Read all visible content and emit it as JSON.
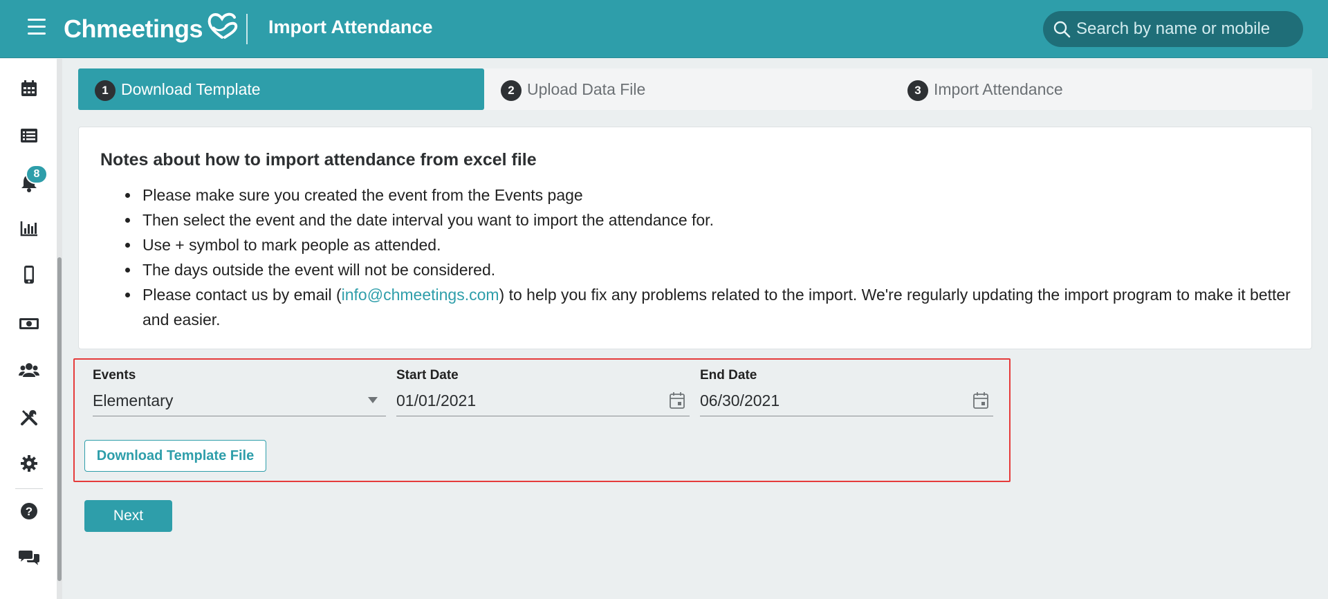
{
  "header": {
    "brand": "Chmeetings",
    "title": "Import Attendance",
    "search_placeholder": "Search by name or mobile"
  },
  "sidebar": {
    "items": [
      {
        "icon": "calendar-icon"
      },
      {
        "icon": "list-icon"
      },
      {
        "icon": "bell-icon",
        "badge": "8"
      },
      {
        "icon": "bar-chart-icon"
      },
      {
        "icon": "mobile-icon"
      },
      {
        "icon": "money-icon"
      },
      {
        "icon": "groups-icon"
      },
      {
        "icon": "tools-icon"
      },
      {
        "icon": "gear-icon"
      },
      {
        "icon": "help-icon"
      },
      {
        "icon": "chat-icon"
      }
    ]
  },
  "steps": [
    {
      "num": "1",
      "label": "Download Template",
      "active": true
    },
    {
      "num": "2",
      "label": "Upload Data File",
      "active": false
    },
    {
      "num": "3",
      "label": "Import Attendance",
      "active": false
    }
  ],
  "notes": {
    "title": "Notes about how to import attendance from excel file",
    "items": [
      "Please make sure you created the event from the Events page",
      "Then select the event and the date interval you want to import the attendance for.",
      "Use + symbol to mark people as attended.",
      "The days outside the event will not be considered."
    ],
    "contact_prefix": "Please contact us by email (",
    "contact_email": "info@chmeetings.com",
    "contact_suffix": ") to help you fix any problems related to the import. We're regularly updating the import program to make it better and easier."
  },
  "form": {
    "events_label": "Events",
    "events_value": "Elementary",
    "start_label": "Start Date",
    "start_value": "01/01/2021",
    "end_label": "End Date",
    "end_value": "06/30/2021",
    "download_button": "Download Template File"
  },
  "next_button": "Next",
  "colors": {
    "primary": "#2e9eaa",
    "highlight_border": "#e53b3b"
  }
}
